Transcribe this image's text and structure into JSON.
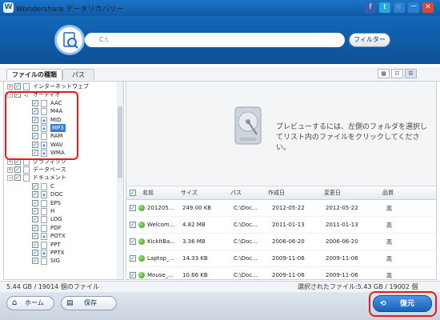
{
  "window": {
    "title": "Wondershare データリカバリー"
  },
  "titlebar_icons": [
    "facebook-icon",
    "twitter-icon",
    "cart-icon",
    "minimize-icon",
    "close-icon"
  ],
  "titlebar_glyphs": [
    "f",
    "t",
    "🛒",
    "－",
    "✕"
  ],
  "search": {
    "path": "C:\\",
    "filter_label": "フィルター"
  },
  "tabs": [
    {
      "label": "ファイルの種類"
    },
    {
      "label": "パス"
    }
  ],
  "view_buttons": [
    "▦",
    "☷",
    "☰"
  ],
  "tree": [
    {
      "label": "インターネットウェブ",
      "level": 0,
      "expander": "+",
      "checked": true,
      "icon": "doc"
    },
    {
      "label": "オーディオ",
      "level": 0,
      "expander": "−",
      "checked": true,
      "icon": "note"
    },
    {
      "label": "AAC",
      "level": 1,
      "checked": true,
      "icon": "doc"
    },
    {
      "label": "M4A",
      "level": 1,
      "checked": true,
      "icon": "doc"
    },
    {
      "label": "MID",
      "level": 1,
      "checked": true,
      "icon": "audio"
    },
    {
      "label": "MP3",
      "level": 1,
      "checked": true,
      "icon": "audio",
      "selected": true
    },
    {
      "label": "RAM",
      "level": 1,
      "checked": true,
      "icon": "doc"
    },
    {
      "label": "WAV",
      "level": 1,
      "checked": true,
      "icon": "audio"
    },
    {
      "label": "WMA",
      "level": 1,
      "checked": true,
      "icon": "audio"
    },
    {
      "label": "グラフィック",
      "level": 0,
      "expander": "+",
      "checked": true,
      "icon": "doc"
    },
    {
      "label": "データベース",
      "level": 0,
      "expander": "+",
      "checked": true,
      "icon": "doc"
    },
    {
      "label": "ドキュメント",
      "level": 0,
      "expander": "−",
      "checked": true,
      "icon": "doc"
    },
    {
      "label": "C",
      "level": 1,
      "checked": true,
      "icon": "doc"
    },
    {
      "label": "DOC",
      "level": 1,
      "checked": true,
      "icon": "audio"
    },
    {
      "label": "EPS",
      "level": 1,
      "checked": true,
      "icon": "doc"
    },
    {
      "label": "H",
      "level": 1,
      "checked": true,
      "icon": "doc"
    },
    {
      "label": "LOG",
      "level": 1,
      "checked": true,
      "icon": "doc"
    },
    {
      "label": "PDF",
      "level": 1,
      "checked": true,
      "icon": "doc"
    },
    {
      "label": "POTX",
      "level": 1,
      "checked": true,
      "icon": "audio"
    },
    {
      "label": "PPT",
      "level": 1,
      "checked": true,
      "icon": "doc"
    },
    {
      "label": "PPTX",
      "level": 1,
      "checked": true,
      "icon": "audio"
    },
    {
      "label": "SIG",
      "level": 1,
      "checked": true,
      "icon": "doc"
    }
  ],
  "preview_message": "プレビューするには、左側のフォルダを選択してリスト内のファイルをクリックしてください。",
  "table": {
    "headers": [
      "名前",
      "サイズ",
      "パス",
      "作成日",
      "変更日",
      "品質"
    ],
    "rows": [
      {
        "name": "201205...",
        "size": "249.00 KB",
        "path": "C:\\Doc...",
        "created": "2012-05-22",
        "modified": "2012-05-22",
        "quality": "高"
      },
      {
        "name": "Welcom...",
        "size": "4.82 MB",
        "path": "C:\\Doc...",
        "created": "2011-01-13",
        "modified": "2011-01-13",
        "quality": "高"
      },
      {
        "name": "KickItBa...",
        "size": "3.36 MB",
        "path": "C:\\Doc...",
        "created": "2006-06-20",
        "modified": "2006-06-20",
        "quality": "高"
      },
      {
        "name": "Laptop_...",
        "size": "14.33 KB",
        "path": "C:\\Doc...",
        "created": "2009-11-06",
        "modified": "2009-11-06",
        "quality": "高"
      },
      {
        "name": "Mouse_...",
        "size": "10.66 KB",
        "path": "C:\\Doc...",
        "created": "2009-11-06",
        "modified": "2009-11-06",
        "quality": "高"
      }
    ]
  },
  "status": {
    "left": "5.44 GB / 19014 個のファイル",
    "right": "選択されたファイル:5.43 GB / 19002 個"
  },
  "bottom": {
    "home_label": "ホーム",
    "save_label": "保存",
    "recover_label": "復元"
  },
  "colors": {
    "accent": "#1468b8",
    "highlight": "#e21b1b",
    "check_green": "#1d8b1d"
  }
}
